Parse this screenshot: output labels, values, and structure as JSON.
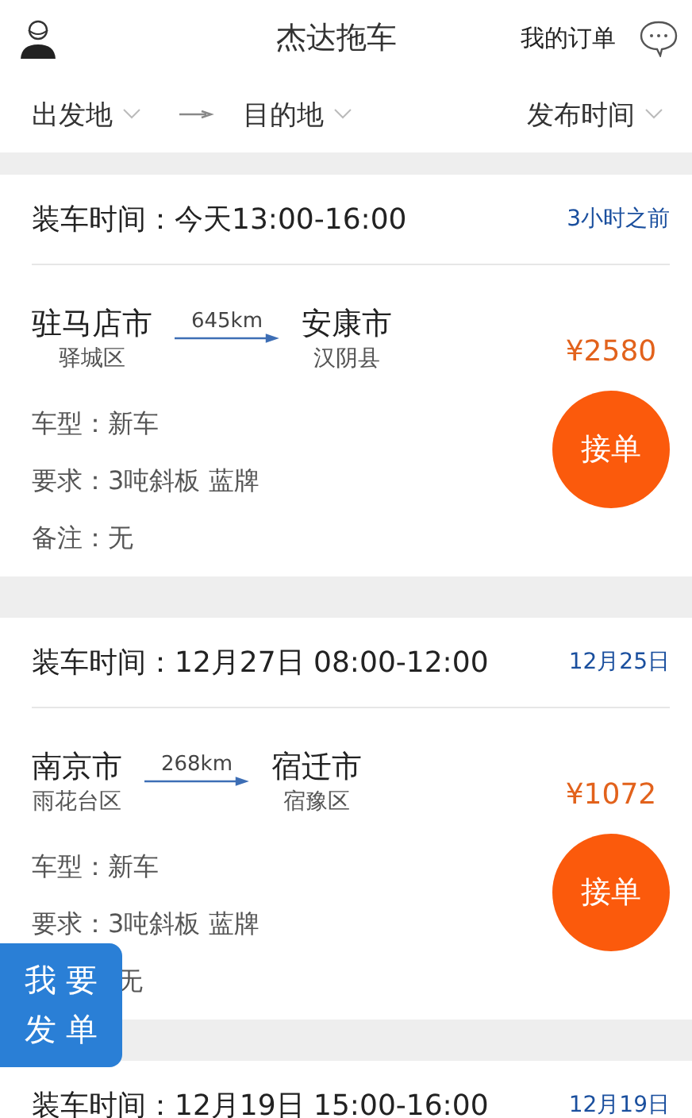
{
  "header": {
    "title": "杰达拖车",
    "orders_link": "我的订单"
  },
  "filters": [
    {
      "label": "出发地",
      "kind": "dropdown"
    },
    {
      "kind": "arrow"
    },
    {
      "label": "目的地",
      "kind": "dropdown"
    },
    {
      "kind": "spacer"
    },
    {
      "label": "发布时间",
      "kind": "dropdown"
    }
  ],
  "orders": [
    {
      "load_label": "装车时间：",
      "load_time": "今天13:00-16:00",
      "posted": "3小时之前",
      "from_city": "驻马店市",
      "from_district": "驿城区",
      "distance": "645km",
      "to_city": "安康市",
      "to_district": "汉阴县",
      "price": "¥2580",
      "accept": "接单",
      "fields": [
        {
          "label": "车型：",
          "value": "新车"
        },
        {
          "label": "要求：",
          "value": "3吨斜板 蓝牌"
        },
        {
          "label": "备注：",
          "value": "无"
        }
      ]
    },
    {
      "load_label": "装车时间：",
      "load_time": "12月27日 08:00-12:00",
      "posted": "12月25日",
      "from_city": "南京市",
      "from_district": "雨花台区",
      "distance": "268km",
      "to_city": "宿迁市",
      "to_district": "宿豫区",
      "price": "¥1072",
      "accept": "接单",
      "fields": [
        {
          "label": "车型：",
          "value": "新车"
        },
        {
          "label": "要求：",
          "value": "3吨斜板 蓝牌"
        },
        {
          "value": "无"
        }
      ]
    },
    {
      "load_label": "装车时间：",
      "load_time": "12月19日 15:00-16:00",
      "posted": "12月19日"
    }
  ],
  "post_button": {
    "line1": "我 要",
    "line2": "发 单"
  }
}
